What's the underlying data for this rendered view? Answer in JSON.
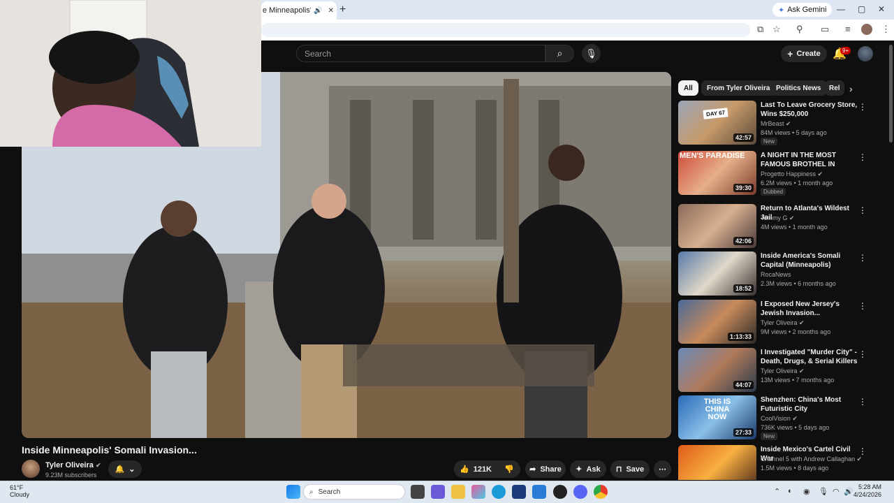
{
  "browser": {
    "tab_title": "e Minneapolis' Somali",
    "tab_audio_icon": "speaker-icon",
    "tab_close_icon": "close-icon",
    "new_tab": "+",
    "ask_gemini": "Ask Gemini",
    "minimize": "—",
    "maximize": "▢",
    "close": "✕"
  },
  "header": {
    "search_placeholder": "Search",
    "create_label": "Create",
    "notification_count": "9+"
  },
  "video": {
    "title": "Inside Minneapolis' Somali Invasion...",
    "channel": "Tyler Oliveira",
    "subscribers": "9.23M subscribers",
    "likes": "121K",
    "share": "Share",
    "ask": "Ask",
    "save": "Save"
  },
  "chips": [
    "All",
    "From Tyler Oliveira",
    "Politics News",
    "Rel"
  ],
  "recommendations": [
    {
      "title": "Last To Leave Grocery Store, Wins $250,000",
      "channel": "MrBeast",
      "meta": "84M views • 5 days ago",
      "badge": "New",
      "duration": "42:57",
      "overlay": "DAY 67"
    },
    {
      "title": "A NIGHT IN THE MOST FAMOUS BROTHEL IN EUROPE",
      "channel": "Progetto Happiness",
      "meta": "6.2M views • 1 month ago",
      "badge": "Dubbed",
      "duration": "39:30",
      "overlay": "MEN'S PARADISE"
    },
    {
      "title": "Return to Atlanta's Wildest Jail",
      "channel": "Tommy G",
      "meta": "4M views • 1 month ago",
      "badge": "",
      "duration": "42:06",
      "overlay": ""
    },
    {
      "title": "Inside America's Somali Capital (Minneapolis)",
      "channel": "RocaNews",
      "meta": "2.3M views • 6 months ago",
      "badge": "",
      "duration": "18:52",
      "overlay": ""
    },
    {
      "title": "I Exposed New Jersey's Jewish Invasion...",
      "channel": "Tyler Oliveira",
      "meta": "9M views • 2 months ago",
      "badge": "",
      "duration": "1:13:33",
      "overlay": ""
    },
    {
      "title": "I Investigated \"Murder City\" - Death, Drugs, & Serial Killers",
      "channel": "Tyler Oliveira",
      "meta": "13M views • 7 months ago",
      "badge": "",
      "duration": "44:07",
      "overlay": ""
    },
    {
      "title": "Shenzhen: China's Most Futuristic City",
      "channel": "CoolVision",
      "meta": "736K views • 5 days ago",
      "badge": "New",
      "duration": "27:33",
      "overlay": "THIS IS CHINA NOW"
    },
    {
      "title": "Inside Mexico's Cartel Civil War",
      "channel": "Channel 5 with Andrew Callaghan",
      "meta": "1.5M views • 8 days ago",
      "badge": "",
      "duration": "",
      "overlay": ""
    }
  ],
  "taskbar": {
    "temp": "61°F",
    "weather": "Cloudy",
    "search": "Search",
    "time": "5:28 AM",
    "date": "4/24/2026"
  },
  "colors": {
    "background": "#0f0f0f",
    "notification_red": "#cc0000",
    "chip_active": "#f1f1f1"
  }
}
